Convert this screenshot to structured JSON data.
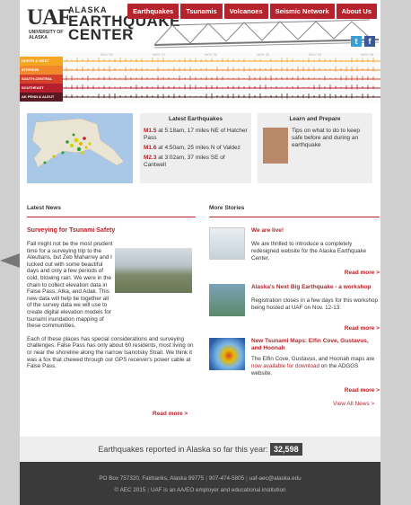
{
  "header": {
    "logo_uaf": "UAF",
    "logo_univ": "UNIVERSITY OF ALASKA",
    "logo_alaska_short": "ALASKA",
    "logo_line1": "ALASKA",
    "logo_line2": "EARTHQUAKE",
    "logo_line3": "CENTER",
    "nav": [
      "Earthquakes",
      "Tsunamis",
      "Volcanoes",
      "Seismic Network",
      "About Us"
    ]
  },
  "seismograph": {
    "rows": [
      {
        "label": "NORTH & WEST",
        "color": "#f5a623"
      },
      {
        "label": "INTERIOR",
        "color": "#f08a2c"
      },
      {
        "label": "SOUTH-CENTRAL",
        "color": "#d6412a"
      },
      {
        "label": "SOUTHEAST",
        "color": "#b51f2e"
      },
      {
        "label": "AK PENN & ALEUT",
        "color": "#5a1820"
      }
    ],
    "dates": [
      "NOV 20",
      "NOV 21",
      "NOV 22",
      "NOV 23",
      "NOV 24",
      "NOV 25"
    ]
  },
  "latest": {
    "title": "Latest Earthquakes",
    "items": [
      {
        "mag": "M1.5",
        "text": "at 5:18am, 17 miles NE of Hatcher Pass"
      },
      {
        "mag": "M1.6",
        "text": "at 4:50am, 25 miles N of Valdez"
      },
      {
        "mag": "M2.3",
        "text": "at 3:02am, 37 miles SE of Cantwell"
      }
    ]
  },
  "learn": {
    "title": "Learn and Prepare",
    "text": "Tips on what to do to keep safe before and during an earthquake"
  },
  "news": {
    "heading": "Latest News",
    "title": "Surveying for Tsunami Safety",
    "para1": "Fall might not be the most prudent time for a surveying trip to the Aleutians, but Zeb Maharrey and I lucked out with some beautiful days and only a few periods of cold, blowing rain. We were in the chain to collect elevation data in False Pass, Atka, and Adak. This new data will help tie together all of the survey data we will use to create digital elevation models for tsunami inundation mapping of these communities.",
    "para2": "Each of these places has special considerations and surveying challenges. False Pass has only about 60 residents, most living on or near the shoreline along the narrow Isanotsky Strait. We think it was a fox that chewed through our GPS receiver's power cable at False Pass.",
    "read_more": "Read more >"
  },
  "stories": {
    "heading": "More Stories",
    "items": [
      {
        "title": "We are live!",
        "text": "We are thrilled to introduce a completely redesigned website for the Alaska Earthquake Center.",
        "read_more": "Read more >"
      },
      {
        "title": "Alaska's Next Big Earthquake - a workshop",
        "text": "Registration closes in a few days for this workshop being hosted at UAF on Nov. 12-13.",
        "read_more": "Read more >"
      },
      {
        "title": "New Tsunami Maps: Elfin Cove, Gustavus, and Hoonah",
        "text_pre": "The Elfin Cove, Gustavus, and Hoonah maps are ",
        "text_link": "now available for download",
        "text_post": " on the ADGGS website.",
        "read_more": "Read more >"
      }
    ],
    "view_all": "View All News >"
  },
  "counter": {
    "label": "Earthquakes reported in Alaska so far this year:",
    "value": "32,598"
  },
  "footer": {
    "line1": [
      "PO Box 757320, Fairbanks, Alaska 99775",
      "907-474-5805",
      "uaf-aec@alaska.edu"
    ],
    "line2": [
      "© AEC 2015",
      "UAF is an AA/EO employer and educational institution"
    ]
  }
}
